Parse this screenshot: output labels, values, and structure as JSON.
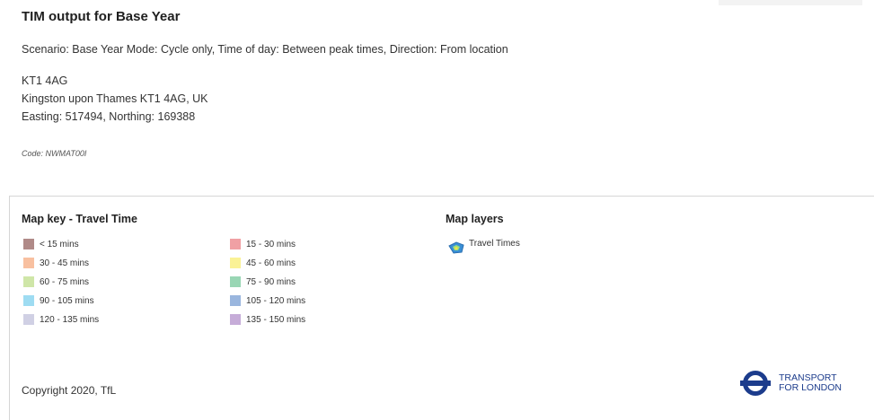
{
  "header": {
    "title": "TIM output for Base Year",
    "scenario": "Scenario: Base Year Mode: Cycle only, Time of day: Between peak times, Direction: From location"
  },
  "location": {
    "postcode": "KT1 4AG",
    "address": "Kingston upon Thames KT1 4AG, UK",
    "coordinates": "Easting: 517494, Northing: 169388"
  },
  "code": "Code: NWMAT00I",
  "map_key": {
    "title": "Map key - Travel Time",
    "items": [
      {
        "label": "< 15 mins",
        "color": "#b08a88"
      },
      {
        "label": "15 - 30 mins",
        "color": "#f0a0a4"
      },
      {
        "label": "30 - 45 mins",
        "color": "#f8c0a0"
      },
      {
        "label": "45 - 60 mins",
        "color": "#faf296"
      },
      {
        "label": "60 - 75 mins",
        "color": "#cfe6a8"
      },
      {
        "label": "75 - 90 mins",
        "color": "#99d6b4"
      },
      {
        "label": "90 - 105 mins",
        "color": "#9edcf2"
      },
      {
        "label": "105 - 120 mins",
        "color": "#9ab6de"
      },
      {
        "label": "120 - 135 mins",
        "color": "#d0d0e4"
      },
      {
        "label": "135 - 150 mins",
        "color": "#c6acd8"
      }
    ]
  },
  "map_layers": {
    "title": "Map layers",
    "items": [
      {
        "label": "Travel Times",
        "icon": "travel-times-layer-icon"
      }
    ]
  },
  "footer": {
    "copyright": "Copyright 2020, TfL",
    "logo_line1": "TRANSPORT",
    "logo_line2": "FOR LONDON",
    "logo_color": "#1c3c8c"
  }
}
